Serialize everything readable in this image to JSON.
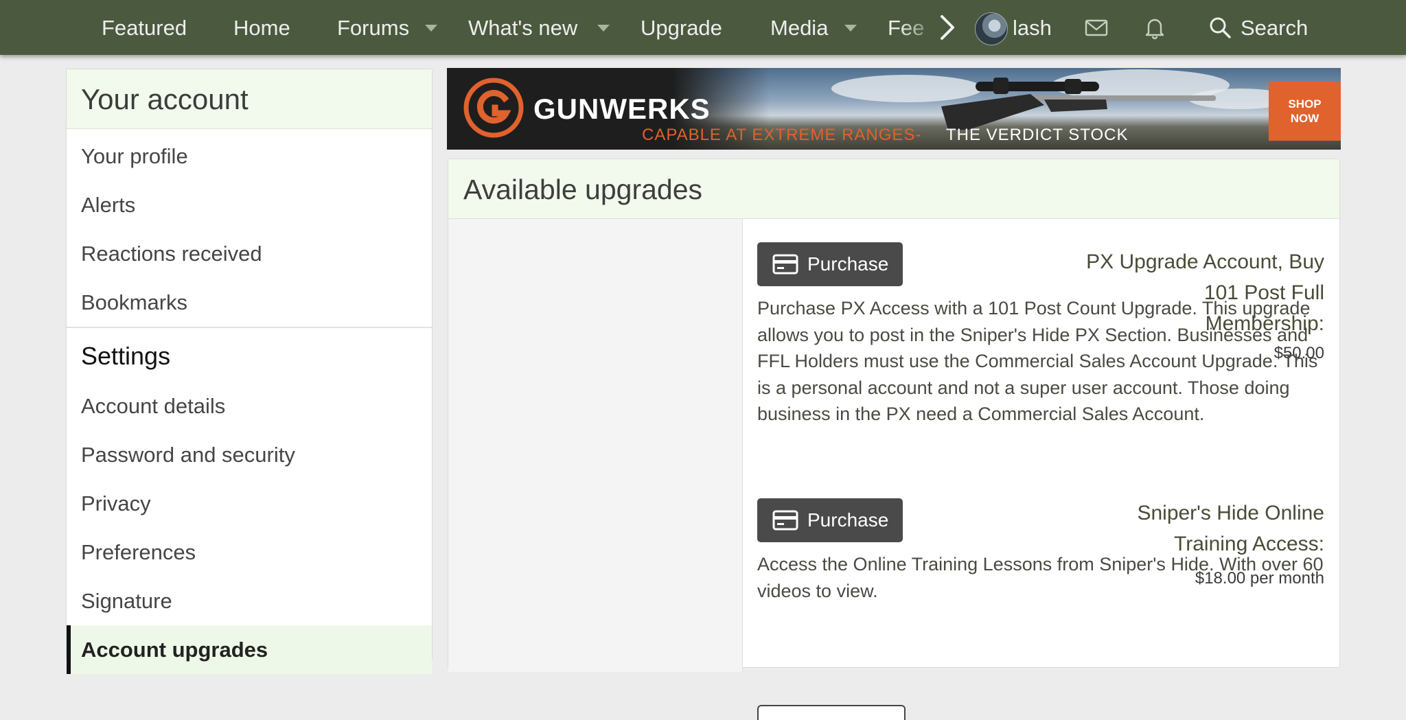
{
  "nav": {
    "items": [
      {
        "label": "Featured"
      },
      {
        "label": "Home"
      },
      {
        "label": "Forums"
      },
      {
        "label": "What's new"
      },
      {
        "label": "Upgrade"
      },
      {
        "label": "Media"
      }
    ],
    "overflow_label": "Fee",
    "username": "lash",
    "search_label": "Search"
  },
  "sidebar": {
    "header": "Your account",
    "items": [
      {
        "label": "Your profile"
      },
      {
        "label": "Alerts"
      },
      {
        "label": "Reactions received"
      },
      {
        "label": "Bookmarks"
      }
    ],
    "settings_heading": "Settings",
    "settings_items": [
      {
        "label": "Account details"
      },
      {
        "label": "Password and security"
      },
      {
        "label": "Privacy"
      },
      {
        "label": "Preferences"
      },
      {
        "label": "Signature"
      },
      {
        "label": "Account upgrades"
      }
    ]
  },
  "banner": {
    "brand": "GUNWERKS",
    "tagline": "CAPABLE AT EXTREME RANGES-",
    "tagline_product": " THE VERDICT STOCK",
    "cta_line1": "SHOP",
    "cta_line2": "NOW"
  },
  "main": {
    "title": "Available upgrades",
    "upgrades": [
      {
        "title_lines": [
          "PX Upgrade Account, Buy",
          "101 Post Full",
          "Membership:"
        ],
        "price": "$50.00",
        "button": "Purchase",
        "description": "Purchase PX Access with a 101 Post Count Upgrade. This upgrade allows you to post in the Sniper's Hide PX Section. Businesses and FFL Holders must use the Commercial Sales Account Upgrade. This is a personal account and not a super user account. Those doing business in the PX need a Commercial Sales Account."
      },
      {
        "title_lines": [
          "Sniper's Hide Online",
          "Training Access:"
        ],
        "price": "$18.00 per month",
        "button": "Purchase",
        "description": "Access the Online Training Lessons from Sniper's Hide. With over 60 videos to view."
      }
    ]
  },
  "colors": {
    "nav_bg": "#4b5a3e",
    "header_tint": "#f1faec",
    "button_bg": "#4a4a4a",
    "brand_orange": "#e0622d"
  },
  "icons": [
    "caret-down-icon",
    "chevron-right-icon",
    "envelope-icon",
    "bell-icon",
    "search-icon",
    "credit-card-icon"
  ]
}
